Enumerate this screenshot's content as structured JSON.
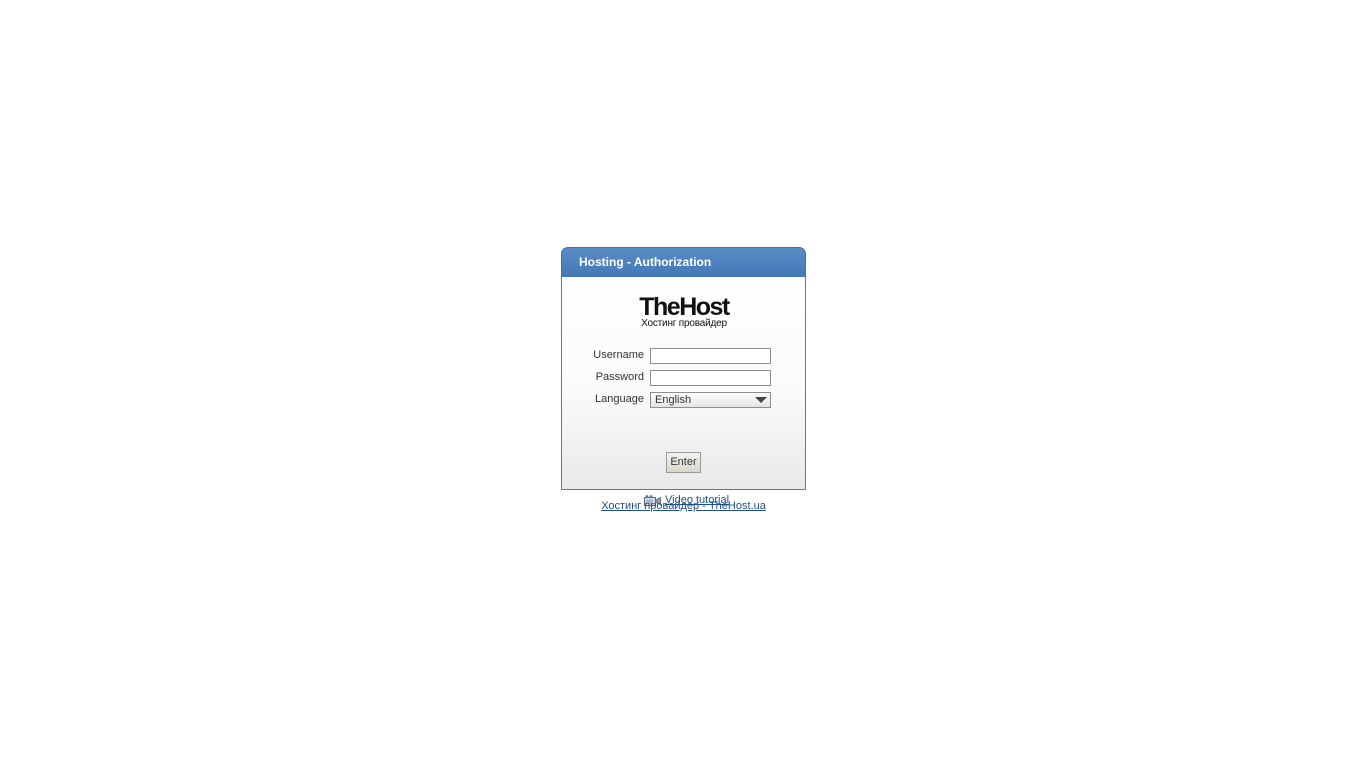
{
  "header": {
    "title": "Hosting - Authorization"
  },
  "logo": {
    "name": "TheHost",
    "tagline": "Хостинг провайдер"
  },
  "form": {
    "username_label": "Username",
    "username_value": "",
    "password_label": "Password",
    "password_value": "",
    "language_label": "Language",
    "language_selected": "English",
    "enter_label": "Enter"
  },
  "links": {
    "video_tutorial": "Video tutorial",
    "footer": "Хостинг провайдер - TheHost.ua"
  },
  "colors": {
    "header_blue": "#4a7db8",
    "link_blue": "#1f4e8c"
  },
  "icons": {
    "video": "video-camera-icon",
    "dropdown": "chevron-down-icon"
  }
}
